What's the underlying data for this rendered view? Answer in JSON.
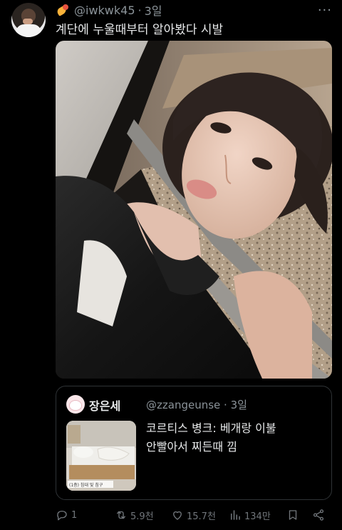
{
  "tweet": {
    "handle": "@iwkwk45",
    "separator": "·",
    "time": "3일",
    "text": "계단에 누울때부터 알아봤다 시발",
    "more": "···"
  },
  "quote": {
    "name": "장은세",
    "handle": "@zzangeunse",
    "separator": "·",
    "time": "3일",
    "text_line1": "코르티스 병크: 베개랑 이불",
    "text_line2": "안빨아서 찌든때 낌",
    "thumb_caption": "(1층) 침대 및 침구"
  },
  "actions": {
    "reply_count": "1",
    "retweet_count": "5.9천",
    "like_count": "15.7천",
    "view_count": "134만"
  },
  "colors": {
    "background": "#000000",
    "text": "#e7e9ea",
    "muted": "#71767b",
    "border": "#2f3336"
  }
}
